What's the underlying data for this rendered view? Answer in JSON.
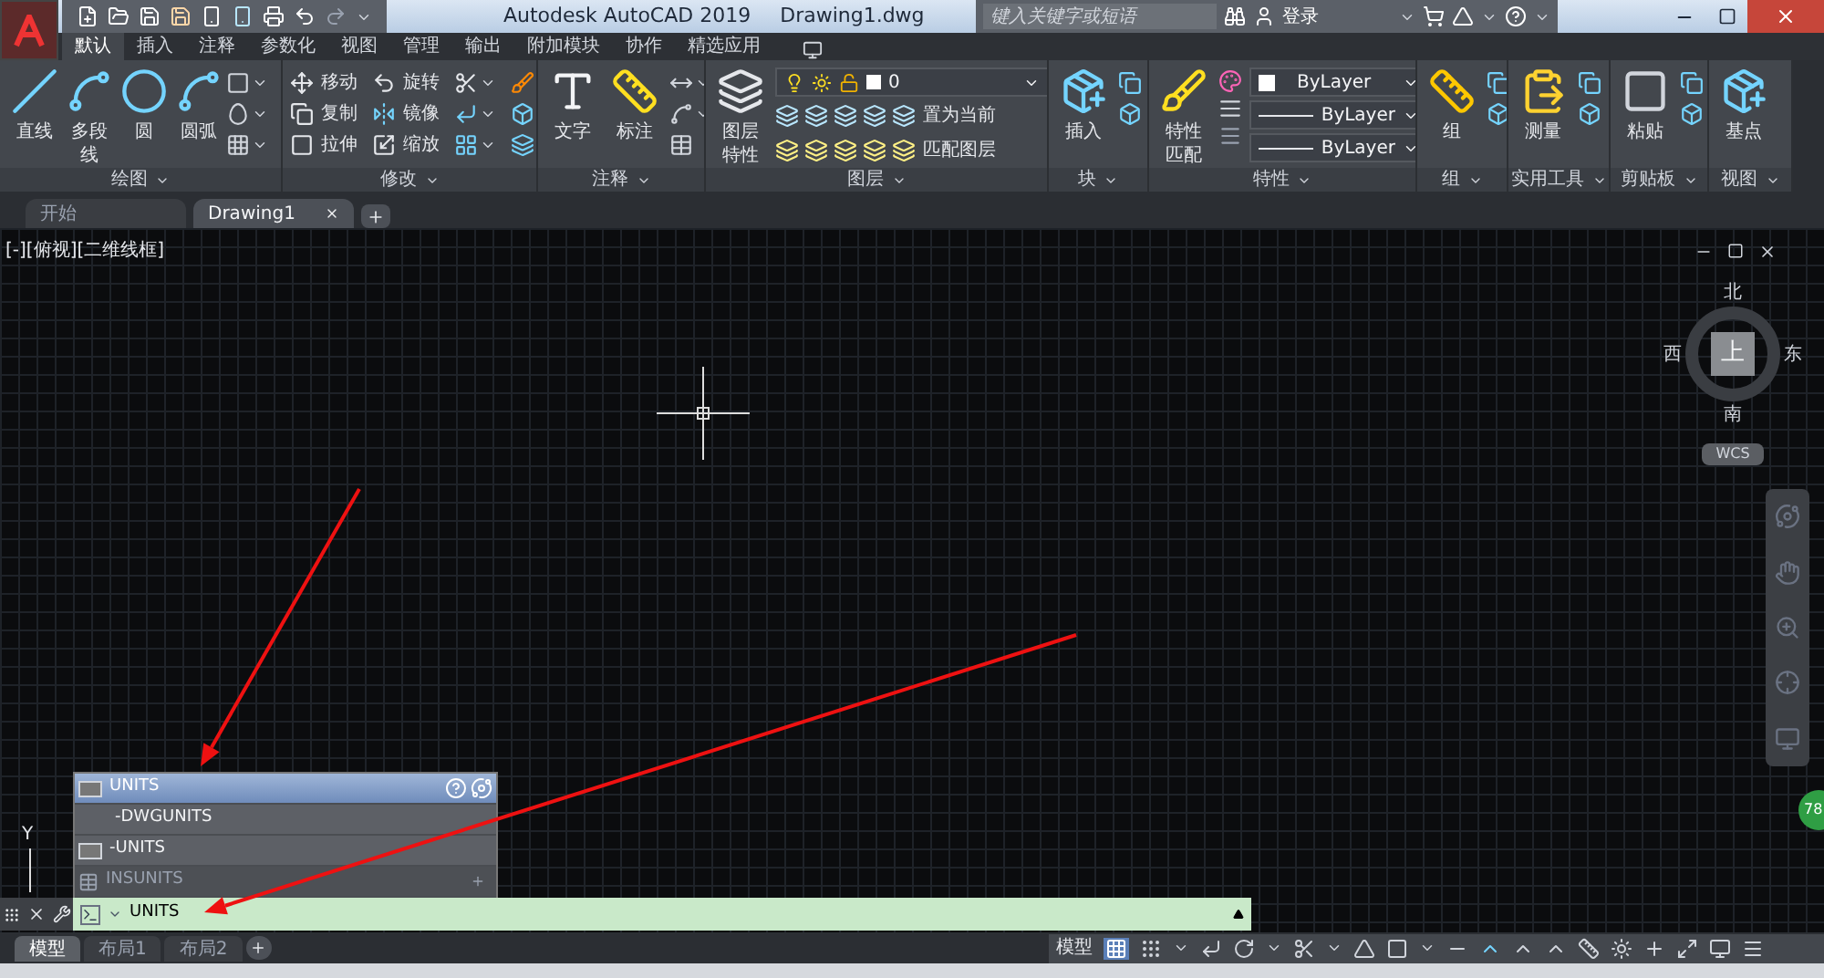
{
  "title_bar": {
    "app_title": "Autodesk AutoCAD 2019",
    "file_name": "Drawing1.dwg",
    "search": {
      "placeholder": "键入关键字或短语"
    },
    "sign_in": "登录"
  },
  "ribbon_tabs": [
    {
      "label": "默认",
      "selected": true
    },
    {
      "label": "插入",
      "selected": false
    },
    {
      "label": "注释",
      "selected": false
    },
    {
      "label": "参数化",
      "selected": false
    },
    {
      "label": "视图",
      "selected": false
    },
    {
      "label": "管理",
      "selected": false
    },
    {
      "label": "输出",
      "selected": false
    },
    {
      "label": "附加模块",
      "selected": false
    },
    {
      "label": "协作",
      "selected": false
    },
    {
      "label": "精选应用",
      "selected": false
    }
  ],
  "ribbon_panels": [
    {
      "kind": "draw",
      "title": "绘图",
      "tools": [
        "直线",
        "多段线",
        "圆",
        "圆弧"
      ]
    },
    {
      "kind": "modify",
      "title": "修改",
      "tools": [
        "移动",
        "旋转",
        "复制",
        "镜像",
        "拉伸",
        "缩放"
      ]
    },
    {
      "kind": "annotate",
      "title": "注释",
      "tools": [
        "文字",
        "标注"
      ]
    },
    {
      "kind": "layers",
      "title": "图层",
      "tools": [
        "图层特性",
        "置为当前",
        "匹配图层"
      ],
      "layer": "0"
    },
    {
      "kind": "single",
      "title": "块",
      "tools": [
        "插入"
      ]
    },
    {
      "kind": "properties",
      "title": "特性",
      "tools": [
        "特性匹配"
      ],
      "dropdowns": [
        "ByLayer",
        "ByLayer",
        "ByLayer"
      ]
    },
    {
      "kind": "single",
      "title": "组",
      "tools": [
        "组"
      ]
    },
    {
      "kind": "single",
      "title": "实用工具",
      "tools": [
        "测量"
      ]
    },
    {
      "kind": "single",
      "title": "剪贴板",
      "tools": [
        "粘贴"
      ]
    },
    {
      "kind": "single",
      "title": "视图",
      "tools": [
        "基点"
      ]
    }
  ],
  "file_tabs": [
    {
      "label": "开始",
      "selected": false
    },
    {
      "label": "Drawing1",
      "selected": true
    }
  ],
  "viewport_label": "[-][俯视][二维线框]",
  "viewcube": {
    "north": "北",
    "south": "南",
    "west": "西",
    "east": "东",
    "face": "上",
    "ucs": "WCS"
  },
  "ucs_icon": {
    "y_label": "Y"
  },
  "side_badge": "78",
  "autocomplete": [
    {
      "label": "UNITS",
      "selected": true,
      "kind": "command"
    },
    {
      "label": "-DWGUNITS",
      "selected": false,
      "kind": "plain"
    },
    {
      "label": "-UNITS",
      "selected": false,
      "kind": "command"
    },
    {
      "label": "INSUNITS",
      "selected": false,
      "kind": "variable"
    }
  ],
  "command_line": {
    "value": "UNITS"
  },
  "layout_tabs": [
    {
      "label": "模型",
      "selected": true
    },
    {
      "label": "布局1",
      "selected": false
    },
    {
      "label": "布局2",
      "selected": false
    }
  ],
  "status_bar": {
    "model": "模型",
    "grid_on": true
  }
}
